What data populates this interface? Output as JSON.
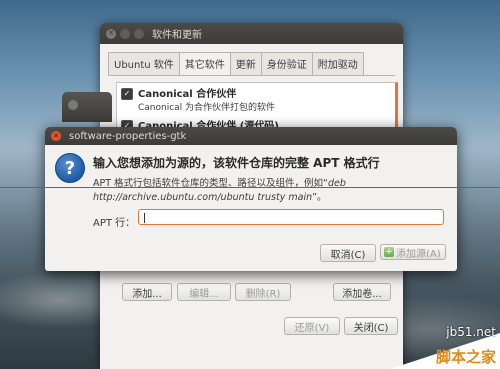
{
  "back_window": {
    "title": "软件和更新",
    "tabs": [
      {
        "label": "Ubuntu 软件",
        "active": false
      },
      {
        "label": "其它软件",
        "active": true
      },
      {
        "label": "更新",
        "active": false
      },
      {
        "label": "身份验证",
        "active": false
      },
      {
        "label": "附加驱动",
        "active": false
      }
    ],
    "sources": [
      {
        "title": "Canonical 合作伙伴",
        "subtitle": "Canonical 为合作伙伴打包的软件",
        "checked": true
      },
      {
        "title": "Canonical 合作伙伴 (源代码)",
        "subtitle": "",
        "checked": true
      }
    ],
    "buttons": {
      "add": "添加...",
      "edit": "编辑...",
      "remove": "删除(R)",
      "add_volume": "添加卷...",
      "revert": "还原(V)",
      "close": "关闭(C)"
    }
  },
  "dialog": {
    "title": "software-properties-gtk",
    "heading": "输入您想添加为源的，该软件仓库的完整 APT 格式行",
    "description_prefix": "APT 格式行包括软件仓库的类型、路径以及组件，例如“",
    "description_example": "deb http://archive.ubuntu.com/ubuntu trusty main",
    "description_suffix": "”。",
    "apt_label": "APT 行：",
    "apt_value": "",
    "cancel_label": "取消(C)",
    "add_source_label": "添加源(A)",
    "accent_color": "#e3743b"
  },
  "watermark": {
    "site": "jb51.net",
    "name": "脚本之家"
  }
}
